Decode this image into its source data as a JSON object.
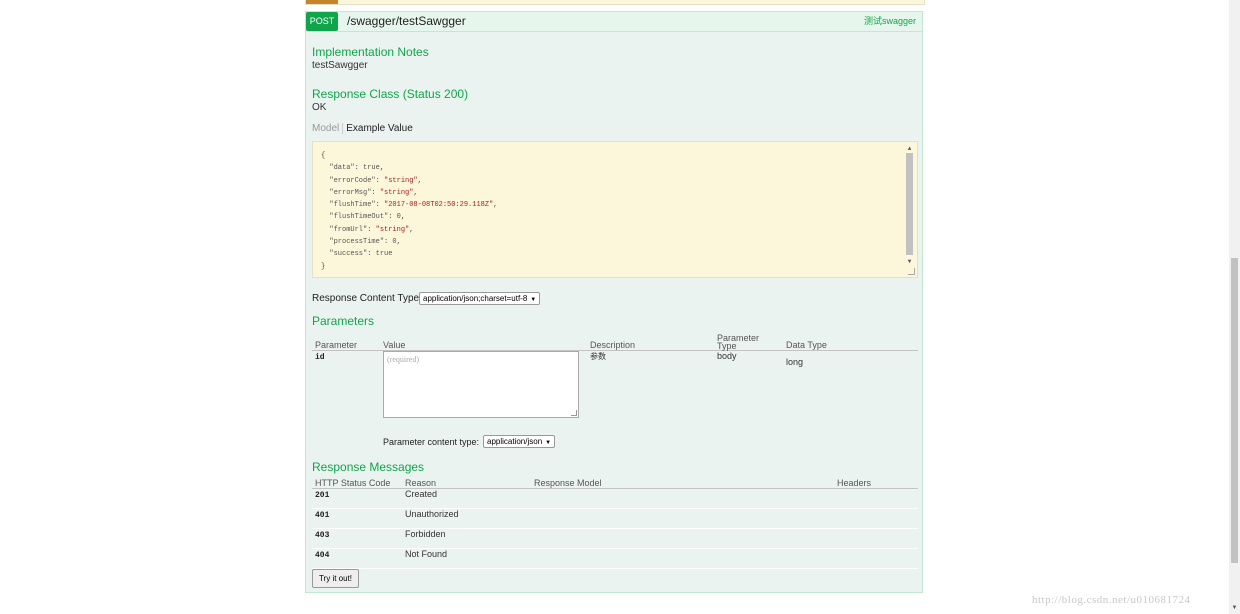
{
  "operation": {
    "method": "POST",
    "path": "/swagger/testSawgger",
    "summary": "测试swagger",
    "implementation_notes_title": "Implementation Notes",
    "implementation_notes": "testSawgger",
    "response_class_title": "Response Class (Status 200)",
    "response_class": "OK"
  },
  "model_tabs": {
    "model": "Model",
    "example": "Example Value"
  },
  "example_value": {
    "open": "{",
    "lines": [
      {
        "key": "\"data\"",
        "value": "true",
        "type": "bool",
        "comma": ","
      },
      {
        "key": "\"errorCode\"",
        "value": "\"string\"",
        "type": "string",
        "comma": ","
      },
      {
        "key": "\"errorMsg\"",
        "value": "\"string\"",
        "type": "string",
        "comma": ","
      },
      {
        "key": "\"flushTime\"",
        "value": "\"2017-08-08T02:50:29.118Z\"",
        "type": "string",
        "comma": ","
      },
      {
        "key": "\"flushTimeOut\"",
        "value": "0",
        "type": "number",
        "comma": ","
      },
      {
        "key": "\"fromUrl\"",
        "value": "\"string\"",
        "type": "string",
        "comma": ","
      },
      {
        "key": "\"processTime\"",
        "value": "0",
        "type": "number",
        "comma": ","
      },
      {
        "key": "\"success\"",
        "value": "true",
        "type": "bool",
        "comma": ""
      }
    ],
    "close": "}"
  },
  "response_content_type": {
    "label": "Response Content Type",
    "selected": "application/json;charset=utf-8"
  },
  "parameters": {
    "title": "Parameters",
    "headers": [
      "Parameter",
      "Value",
      "Description",
      "Parameter Type",
      "Data Type"
    ],
    "rows": [
      {
        "name": "id",
        "placeholder": "(required)",
        "description": "参数",
        "param_type": "body",
        "data_type": "long"
      }
    ],
    "content_type_label": "Parameter content type:",
    "content_type_selected": "application/json"
  },
  "response_messages": {
    "title": "Response Messages",
    "headers": [
      "HTTP Status Code",
      "Reason",
      "Response Model",
      "Headers"
    ],
    "rows": [
      {
        "code": "201",
        "reason": "Created"
      },
      {
        "code": "401",
        "reason": "Unauthorized"
      },
      {
        "code": "403",
        "reason": "Forbidden"
      },
      {
        "code": "404",
        "reason": "Not Found"
      }
    ]
  },
  "try_button": "Try it out!",
  "watermark": "http://blog.csdn.net/u010681724",
  "colors": {
    "post_green": "#10a54a",
    "op_background": "#ebf3f1",
    "example_background": "#fcf6db",
    "string_red": "#a5221e"
  }
}
